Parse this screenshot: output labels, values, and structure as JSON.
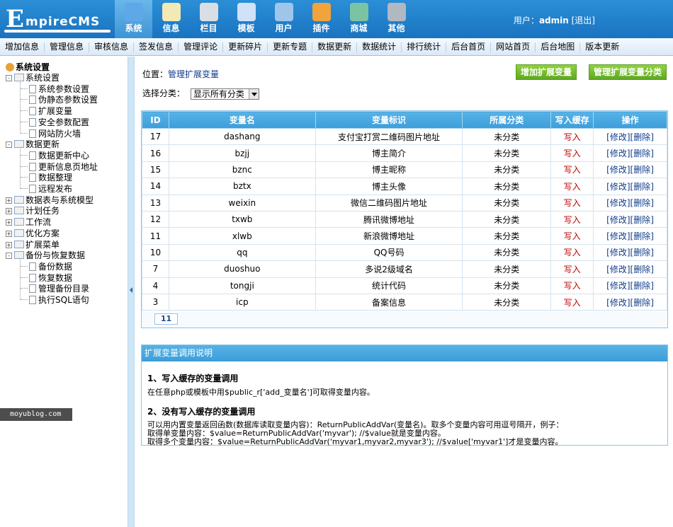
{
  "header": {
    "logo_big": "E",
    "logo_rest": "mpireCMS",
    "nav": [
      {
        "label": "系统",
        "icon": "globe-icon",
        "color": "#5fa8e8",
        "active": true
      },
      {
        "label": "信息",
        "icon": "notepad-icon",
        "color": "#f2e9b5"
      },
      {
        "label": "栏目",
        "icon": "folder-icon",
        "color": "#d9dee5"
      },
      {
        "label": "模板",
        "icon": "template-icon",
        "color": "#cfe2f7"
      },
      {
        "label": "用户",
        "icon": "user-icon",
        "color": "#9fc6ea"
      },
      {
        "label": "插件",
        "icon": "tools-icon",
        "color": "#f1a33c"
      },
      {
        "label": "商城",
        "icon": "card-icon",
        "color": "#7bc4a3"
      },
      {
        "label": "其他",
        "icon": "gear-icon",
        "color": "#b0b8c2"
      }
    ],
    "user_label": "用户：",
    "user_name": "admin",
    "logout": "[退出]"
  },
  "submenu": [
    "增加信息",
    "管理信息",
    "审核信息",
    "签发信息",
    "管理评论",
    "更新碎片",
    "更新专题",
    "数据更新",
    "数据统计",
    "排行统计",
    "后台首页",
    "网站首页",
    "后台地图",
    "版本更新"
  ],
  "tree": {
    "root": "系统设置",
    "groups": [
      {
        "label": "系统设置",
        "open": true,
        "children": [
          "系统参数设置",
          "伪静态参数设置",
          "扩展变量",
          "安全参数配置",
          "网站防火墙"
        ]
      },
      {
        "label": "数据更新",
        "open": true,
        "children": [
          "数据更新中心",
          "更新信息页地址",
          "数据整理",
          "远程发布"
        ]
      },
      {
        "label": "数据表与系统模型",
        "open": false,
        "children": []
      },
      {
        "label": "计划任务",
        "open": false,
        "children": []
      },
      {
        "label": "工作流",
        "open": false,
        "children": []
      },
      {
        "label": "优化方案",
        "open": false,
        "children": []
      },
      {
        "label": "扩展菜单",
        "open": false,
        "children": []
      },
      {
        "label": "备份与恢复数据",
        "open": true,
        "children": [
          "备份数据",
          "恢复数据",
          "管理备份目录",
          "执行SQL语句"
        ]
      }
    ],
    "watermark": "moyublog.com"
  },
  "main": {
    "position_label": "位置：",
    "position_link": "管理扩展变量",
    "btn_add": "增加扩展变量",
    "btn_manage_class": "管理扩展变量分类",
    "select_label": "选择分类：",
    "select_value": "显示所有分类",
    "table": {
      "headers": [
        "ID",
        "变量名",
        "变量标识",
        "所属分类",
        "写入缓存",
        "操作"
      ],
      "rows": [
        [
          "17",
          "dashang",
          "支付宝打赏二维码图片地址",
          "未分类",
          "写入"
        ],
        [
          "16",
          "bzjj",
          "博主简介",
          "未分类",
          "写入"
        ],
        [
          "15",
          "bznc",
          "博主昵称",
          "未分类",
          "写入"
        ],
        [
          "14",
          "bztx",
          "博主头像",
          "未分类",
          "写入"
        ],
        [
          "13",
          "weixin",
          "微信二维码图片地址",
          "未分类",
          "写入"
        ],
        [
          "12",
          "txwb",
          "腾讯微博地址",
          "未分类",
          "写入"
        ],
        [
          "11",
          "xlwb",
          "新浪微博地址",
          "未分类",
          "写入"
        ],
        [
          "10",
          "qq",
          "QQ号码",
          "未分类",
          "写入"
        ],
        [
          "7",
          "duoshuo",
          "多说2级域名",
          "未分类",
          "写入"
        ],
        [
          "4",
          "tongji",
          "统计代码",
          "未分类",
          "写入"
        ],
        [
          "3",
          "icp",
          "备案信息",
          "未分类",
          "写入"
        ]
      ],
      "op_edit": "[修改]",
      "op_delete": "[删除]",
      "total": "11"
    },
    "help": {
      "title": "扩展变量调用说明",
      "h1": "1、写入缓存的变量调用",
      "p1": "在任意php或模板中用$public_r['add_变量名']可取得变量内容。",
      "h2": "2、没有写入缓存的变量调用",
      "p2": "可以用内置变量返回函数(数据库读取变量内容)：ReturnPublicAddVar(变量名)。取多个变量内容可用逗号隔开，例子：",
      "p3": "取得单变量内容：$value=ReturnPublicAddVar('myvar'); //$value就是变量内容。",
      "p4": "取得多个变量内容：$value=ReturnPublicAddVar('myvar1,myvar2,myvar3'); //$value['myvar1']才是变量内容。"
    }
  }
}
